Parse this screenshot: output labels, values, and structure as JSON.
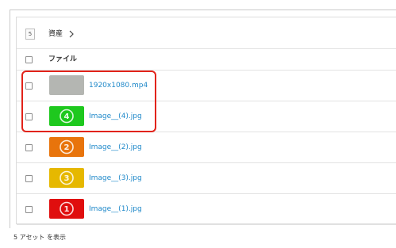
{
  "breadcrumb": {
    "count": "5",
    "label": "資産",
    "chevron_icon": "chevron-right-icon"
  },
  "table": {
    "header_label": "ファイル",
    "rows": [
      {
        "name": "1920x1080.mp4",
        "thumb_color": "#b4b6b2",
        "thumb_number": ""
      },
      {
        "name": "Image__(4).jpg",
        "thumb_color": "#1ec81e",
        "thumb_number": "4"
      },
      {
        "name": "Image__(2).jpg",
        "thumb_color": "#e8740c",
        "thumb_number": "2"
      },
      {
        "name": "Image__(3).jpg",
        "thumb_color": "#e6b800",
        "thumb_number": "3"
      },
      {
        "name": "Image__(1).jpg",
        "thumb_color": "#e00e0e",
        "thumb_number": "1"
      }
    ]
  },
  "highlight_color": "#e2231a",
  "link_color": "#1e88c9",
  "footer_text": "5 アセット を表示"
}
